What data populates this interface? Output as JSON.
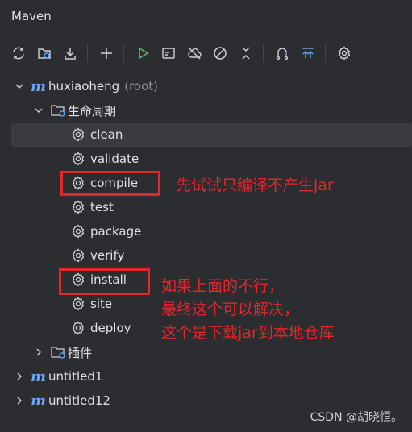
{
  "panel": {
    "title": "Maven"
  },
  "toolbar": {
    "buttons": [
      {
        "name": "reload-icon"
      },
      {
        "name": "reload-folder-icon"
      },
      {
        "name": "download-icon"
      },
      {
        "name": "add-icon"
      },
      {
        "name": "run-icon"
      },
      {
        "name": "execute-goal-icon"
      },
      {
        "name": "offline-icon"
      },
      {
        "name": "skip-tests-icon"
      },
      {
        "name": "collapse-icon"
      },
      {
        "name": "dependencies-icon"
      },
      {
        "name": "show-diagram-icon"
      },
      {
        "name": "settings-icon"
      }
    ]
  },
  "tree": {
    "root": {
      "name": "huxiaoheng",
      "suffix": "(root)"
    },
    "lifecycle_label": "生命周期",
    "goals": [
      "clean",
      "validate",
      "compile",
      "test",
      "package",
      "verify",
      "install",
      "site",
      "deploy"
    ],
    "plugins_label": "插件",
    "projects": [
      "untitled1",
      "untitled12"
    ]
  },
  "annotations": {
    "compile_note": "先试试只编译不产生jar",
    "install_note_1": "如果上面的不行，",
    "install_note_2": "最终这个可以解决，",
    "install_note_3": "这个是下载jar到本地仓库"
  },
  "colors": {
    "accent": "#6aa7f5",
    "annotation": "#e5262b",
    "run": "#5fb865"
  },
  "watermark": "CSDN @胡晓恒。"
}
